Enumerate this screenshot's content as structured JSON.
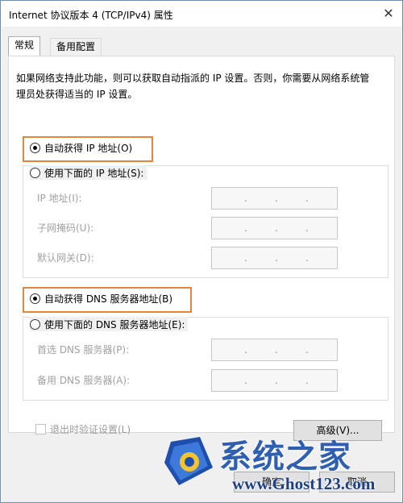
{
  "window": {
    "title": "Internet 协议版本 4 (TCP/IPv4) 属性",
    "close_glyph": "✕"
  },
  "tabs": [
    {
      "label": "常规",
      "active": true
    },
    {
      "label": "备用配置",
      "active": false
    }
  ],
  "intro_text": "如果网络支持此功能，则可以获取自动指派的 IP 设置。否则，你需要从网络系统管理员处获得适当的 IP 设置。",
  "ip_section": {
    "auto_option": "自动获得 IP 地址(O)",
    "manual_option": "使用下面的 IP 地址(S):",
    "fields": [
      {
        "label": "IP 地址(I):"
      },
      {
        "label": "子网掩码(U):"
      },
      {
        "label": "默认网关(D):"
      }
    ]
  },
  "dns_section": {
    "auto_option": "自动获得 DNS 服务器地址(B)",
    "manual_option": "使用下面的 DNS 服务器地址(E):",
    "fields": [
      {
        "label": "首选 DNS 服务器(P):"
      },
      {
        "label": "备用 DNS 服务器(A):"
      }
    ]
  },
  "validate_checkbox": "退出时验证设置(L)",
  "buttons": {
    "advanced": "高级(V)...",
    "ok": "确定",
    "cancel": "取消"
  },
  "ip_separator": ".",
  "watermark": {
    "brand": "系统之家",
    "url": "www.Ghost123.com"
  },
  "colors": {
    "highlight": "#e8843a",
    "disabled_text": "#a0a0a0",
    "brand_blue": "#2f5fb0"
  }
}
